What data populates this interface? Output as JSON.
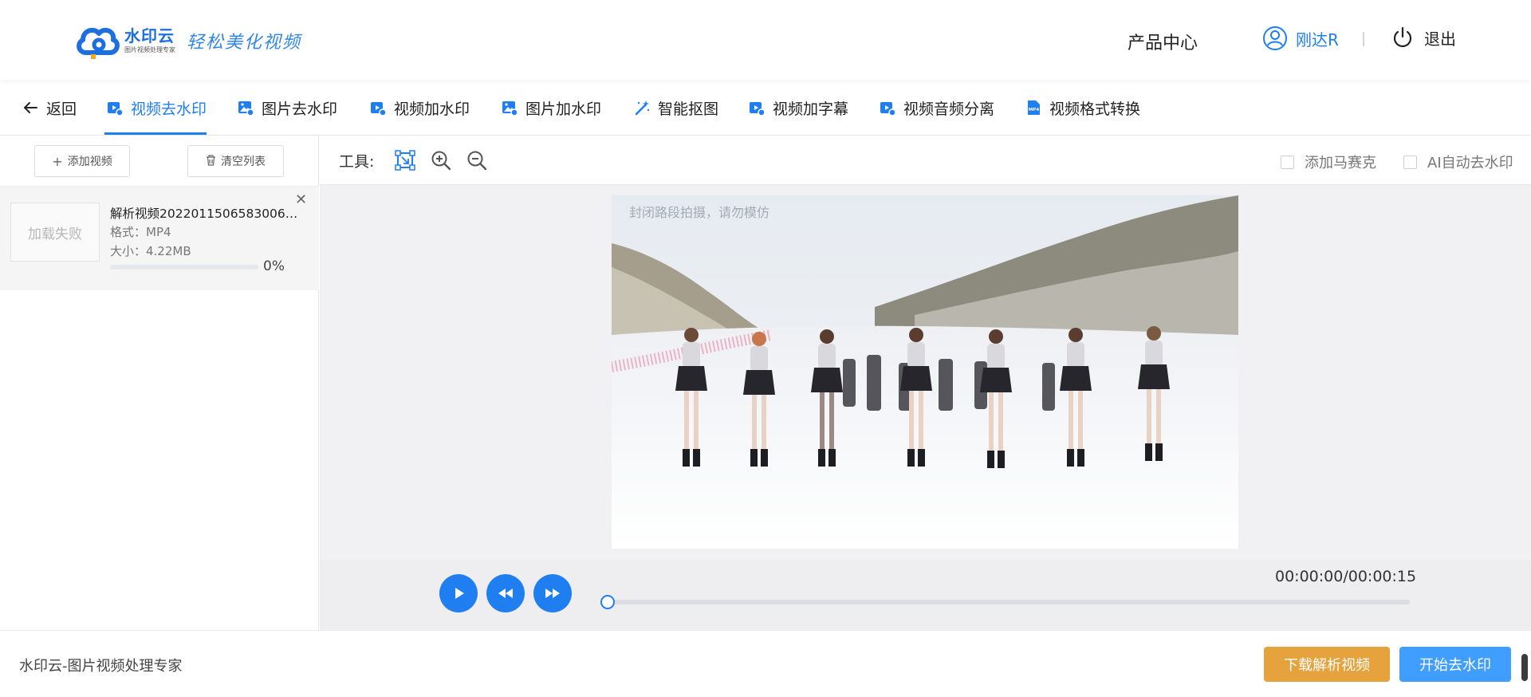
{
  "header": {
    "logo_name": "水印云",
    "logo_subtitle": "图片视频处理专家",
    "logo_slogan": "轻松美化视频",
    "product_center": "产品中心",
    "username": "刚达R",
    "logout": "退出"
  },
  "nav": {
    "back": "返回",
    "items": [
      {
        "label": "视频去水印",
        "active": true
      },
      {
        "label": "图片去水印"
      },
      {
        "label": "视频加水印"
      },
      {
        "label": "图片加水印"
      },
      {
        "label": "智能抠图"
      },
      {
        "label": "视频加字幕"
      },
      {
        "label": "视频音频分离"
      },
      {
        "label": "视频格式转换"
      }
    ]
  },
  "left_panel": {
    "add_video": "添加视频",
    "clear_list": "清空列表",
    "file": {
      "thumb_status": "加载失败",
      "name": "解析视频20220115065830067...",
      "format": "格式：MP4",
      "size": "大小：4.22MB",
      "progress": 0,
      "progress_text": "0%"
    }
  },
  "toolbar": {
    "label": "工具:",
    "icons": [
      "select-area-icon",
      "zoom-in-icon",
      "zoom-out-icon"
    ],
    "add_mosaic": "添加马赛克",
    "ai_auto_remove": "AI自动去水印"
  },
  "video": {
    "watermark_text": "封闭路段拍摄，请勿模仿"
  },
  "player": {
    "time": "00:00:00/00:00:15",
    "position": 0
  },
  "footer": {
    "brand_text": "水印云-图片视频处理专家",
    "download_button": "下载解析视频",
    "start_button": "开始去水印"
  },
  "colors": {
    "accent": "#1f7ef0",
    "download_button": "#e6a23c",
    "start_button": "#409eff"
  }
}
